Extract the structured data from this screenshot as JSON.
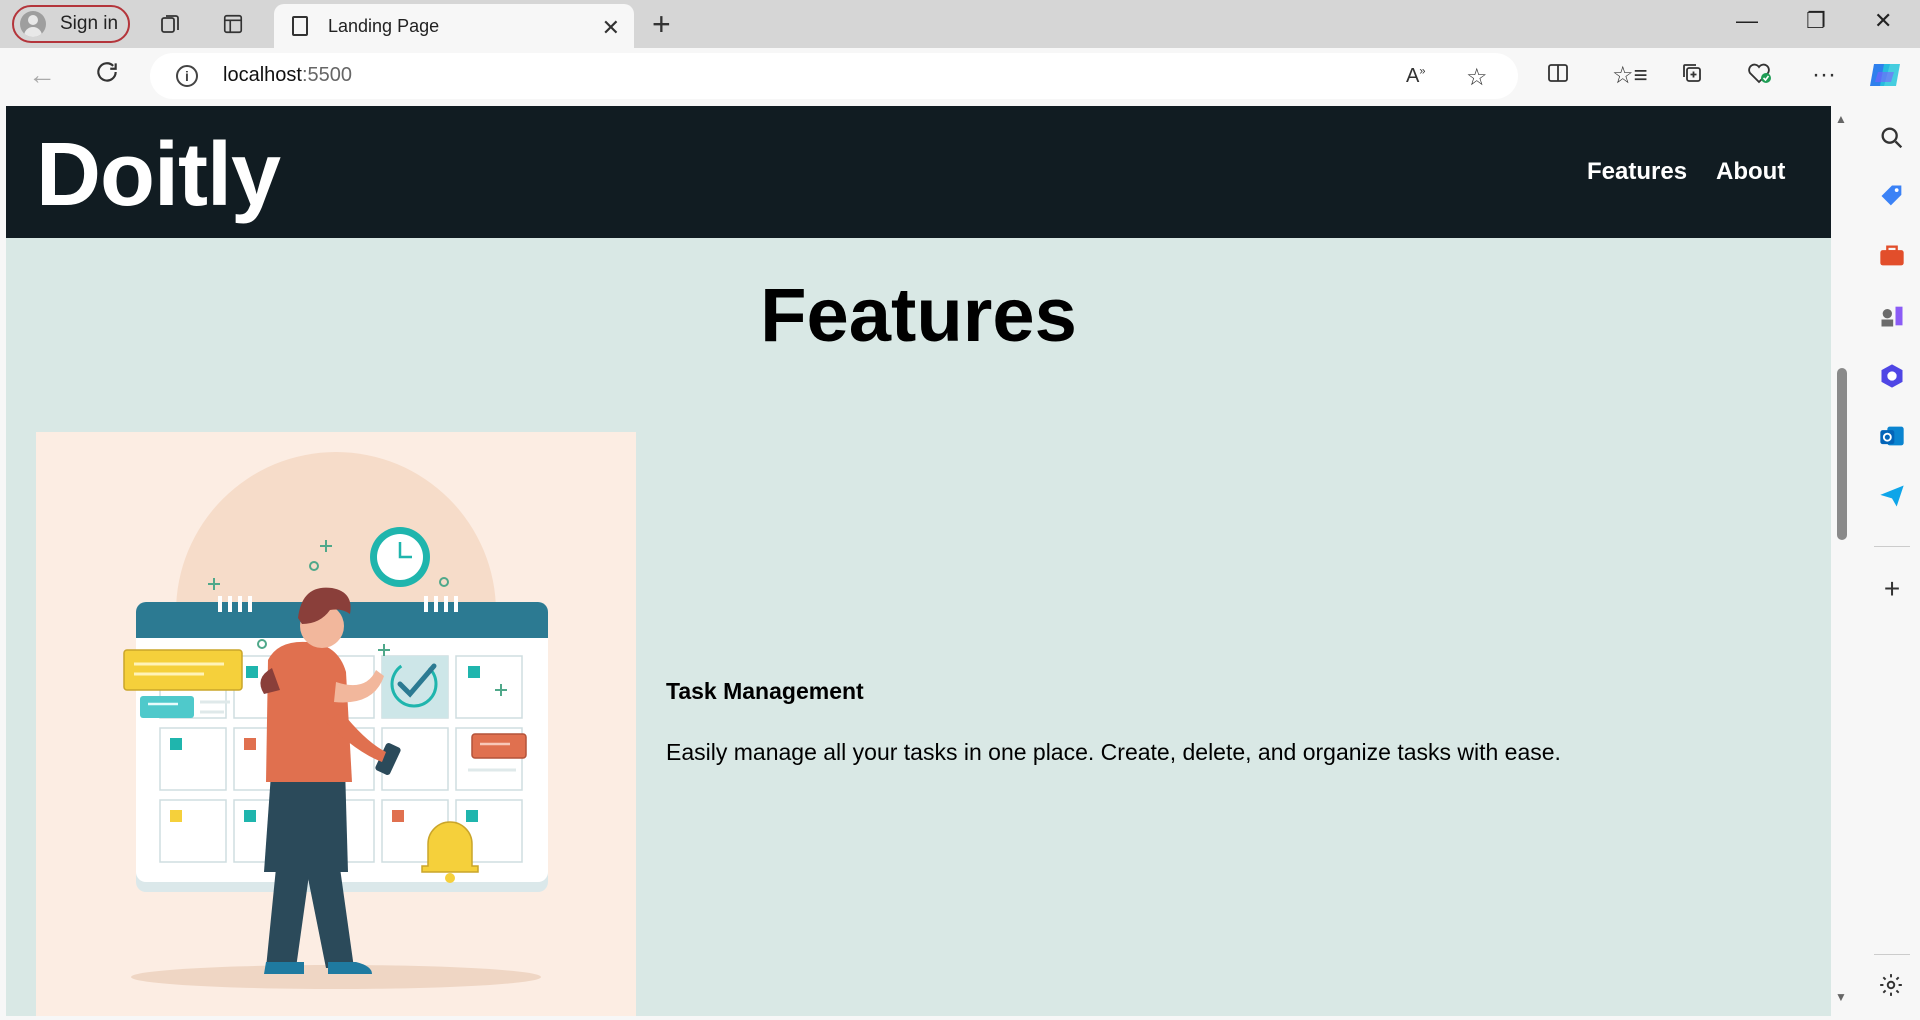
{
  "browser": {
    "signin_label": "Sign in",
    "tab_title": "Landing Page",
    "url_host": "localhost",
    "url_port": ":5500"
  },
  "site": {
    "logo": "Doitly",
    "nav": [
      "Features",
      "About"
    ]
  },
  "features": {
    "heading": "Features",
    "items": [
      {
        "title": "Task Management",
        "description": "Easily manage all your tasks in one place. Create, delete, and organize tasks with ease.",
        "image_icon": "calendar-task-illustration"
      }
    ]
  },
  "colors": {
    "header_bg": "#111c22",
    "page_bg": "#d9e8e5",
    "image_bg": "#fcede3",
    "accent_teal": "#1fb5ad",
    "accent_orange": "#e0704f"
  }
}
